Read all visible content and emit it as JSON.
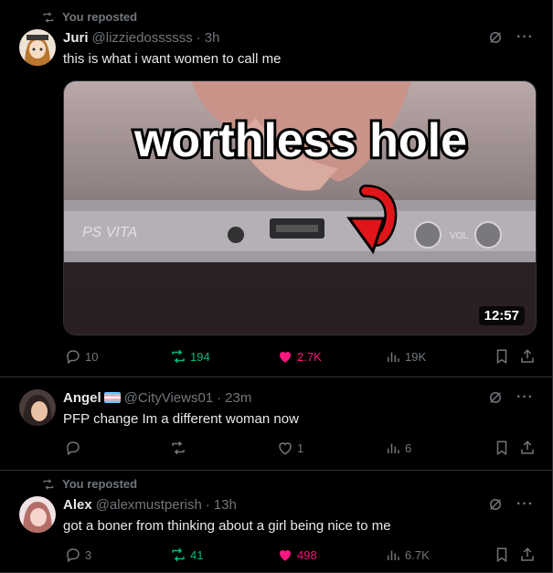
{
  "posts": [
    {
      "repost_label": "You reposted",
      "author_name": "Juri",
      "handle": "@lizziedossssss",
      "time": "3h",
      "text": "this is what i want women to call me",
      "media": {
        "caption": "worthless hole",
        "duration": "12:57",
        "port_label": "PS VITA",
        "button_label": "VOL"
      },
      "stats": {
        "replies": "10",
        "reposts": "194",
        "likes": "2.7K",
        "views": "19K"
      }
    },
    {
      "author_name": "Angel",
      "handle": "@CityViews01",
      "time": "23m",
      "text": "PFP change Im a different woman now",
      "stats": {
        "replies": "",
        "reposts": "",
        "likes": "1",
        "views": "6"
      }
    },
    {
      "repost_label": "You reposted",
      "author_name": "Alex",
      "handle": "@alexmustperish",
      "time": "13h",
      "text": "got a boner from thinking about a girl being nice to me",
      "stats": {
        "replies": "3",
        "reposts": "41",
        "likes": "498",
        "views": "6.7K"
      }
    }
  ],
  "icons": {
    "repost": "repost-icon",
    "grok": "grok-icon",
    "more": "more-icon",
    "reply": "reply-icon",
    "like": "heart-icon",
    "views": "views-icon",
    "bookmark": "bookmark-icon",
    "share": "share-icon"
  },
  "colors": {
    "repost_active": "#00ba7c",
    "like_active": "#f91880",
    "muted": "#71767b"
  }
}
